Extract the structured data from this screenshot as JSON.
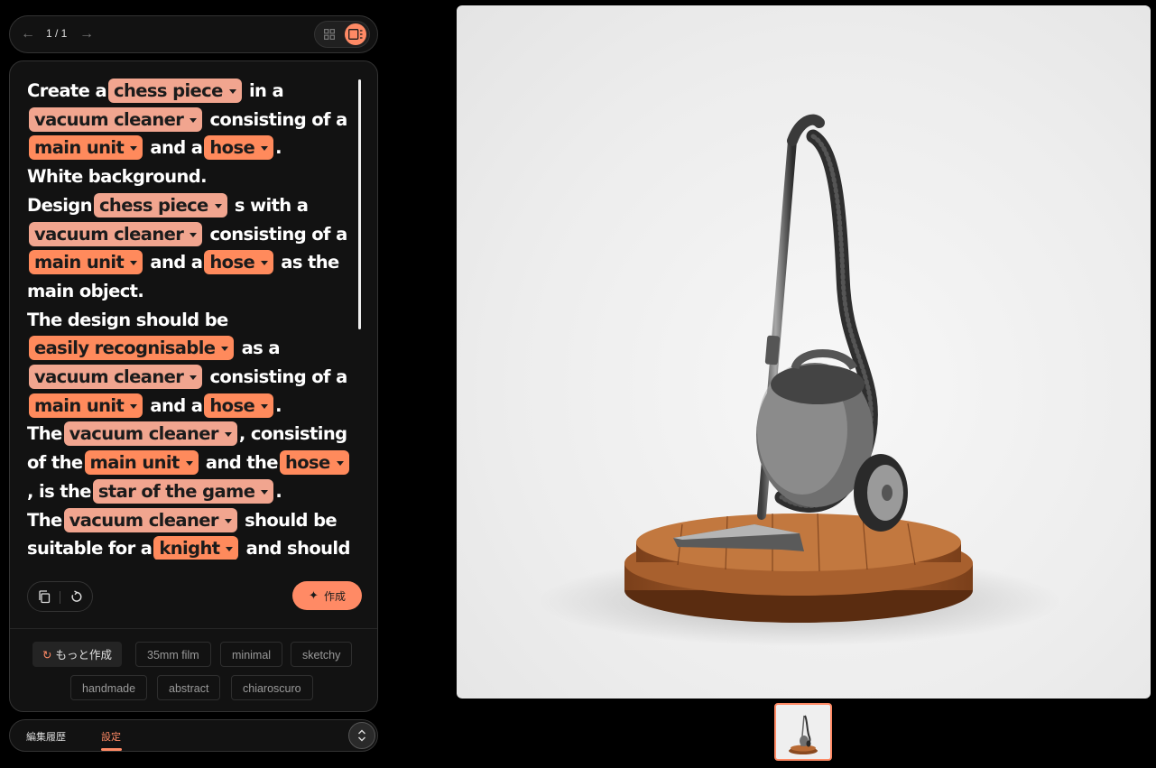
{
  "nav": {
    "page_counter": "1 / 1",
    "prev_icon": "arrow-left-icon",
    "next_icon": "arrow-right-icon"
  },
  "prompt": {
    "accent_chip_light": "#f1a58f",
    "accent_chip_dark": "#ff8a5c",
    "t1": "Create a",
    "chip_chess_1": "chess piece",
    "t2": "in a",
    "chip_vacuum_1": "vacuum cleaner",
    "t3": "consisting of a",
    "chip_main_1": "main unit",
    "t4": "and a",
    "chip_hose_1": "hose",
    "t5": ".",
    "t6": "White background.",
    "t7": "Design",
    "chip_chess_2": "chess piece",
    "t8": "s with a",
    "chip_vacuum_2": "vacuum cleaner",
    "t9": "consisting of a",
    "chip_main_2": "main unit",
    "t10": "and a",
    "chip_hose_2": "hose",
    "t11": "as the main object.",
    "t12": "The design should be",
    "chip_easily": "easily recognisable",
    "t13": "as a",
    "chip_vacuum_3": "vacuum cleaner",
    "t14": "consisting of a",
    "chip_main_3": "main unit",
    "t15": "and a",
    "chip_hose_3": "hose",
    "t16": ".",
    "t17": "The",
    "chip_vacuum_4": "vacuum cleaner",
    "t18": ", consisting of the",
    "chip_main_4": "main unit",
    "t19": "and the",
    "chip_hose_4": "hose",
    "t20": ", is the",
    "chip_star": "star of the game",
    "t21": ".",
    "t22": "The",
    "chip_vacuum_5": "vacuum cleaner",
    "t23": "should be suitable for a",
    "chip_knight": "knight",
    "t24": "and should"
  },
  "actions": {
    "create_label": "作成",
    "more_label": "もっと作成"
  },
  "styles": [
    "35mm film",
    "minimal",
    "sketchy",
    "handmade",
    "abstract",
    "chiaroscuro"
  ],
  "tabs": {
    "history": "編集履歴",
    "settings": "設定"
  }
}
